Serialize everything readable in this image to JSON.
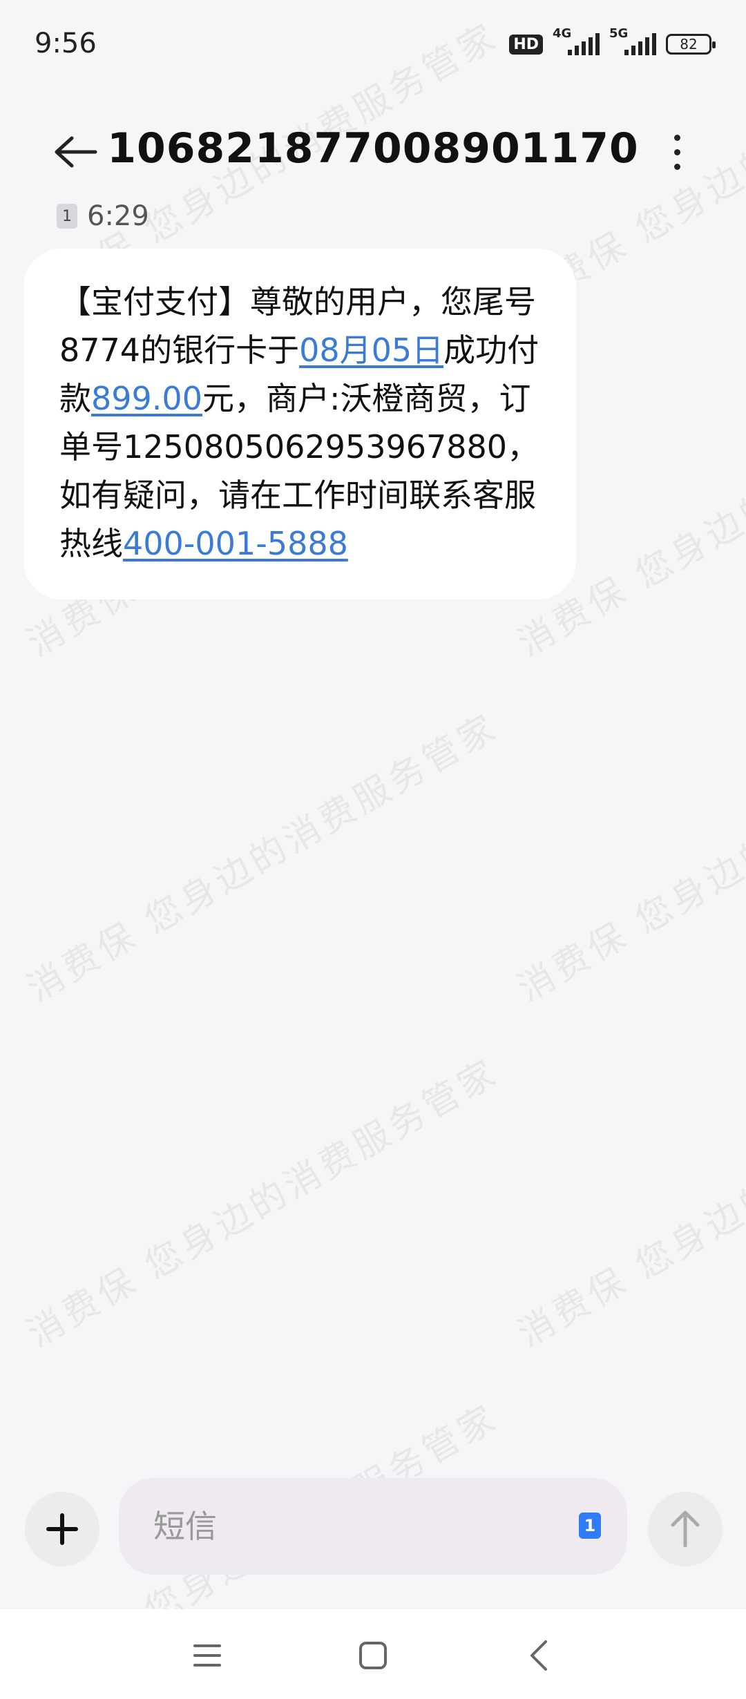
{
  "status_bar": {
    "time": "9:56",
    "hd": "HD",
    "network1": "4G",
    "network2": "5G",
    "battery": "82"
  },
  "header": {
    "title": "10682187700890117​0"
  },
  "message": {
    "sim_slot": "1",
    "time": "6:29",
    "text_part1": "【宝付支付】尊敬的用户，您尾号8774的银行卡于",
    "link_date": "08月05日",
    "text_part2": "成功付款",
    "link_amount": "899.00",
    "text_part3": "元，商户:沃橙商贸，订单号1250805062953967880，如有疑问，请在工作时间联系客服热线",
    "link_phone": "400-001-5888"
  },
  "watermark": {
    "text": "消费保 您身边的消费服务管家"
  },
  "input": {
    "placeholder": "短信",
    "sim_slot": "1"
  },
  "colors": {
    "link": "#3a7bd5",
    "sim_badge": "#2f7cf6",
    "background": "#f6f6f8"
  },
  "icons": {
    "back": "arrow-left-icon",
    "more": "more-vertical-icon",
    "plus": "plus-icon",
    "send": "arrow-up-icon",
    "nav_menu": "menu-icon",
    "nav_home": "square-icon",
    "nav_back": "chevron-left-icon"
  }
}
